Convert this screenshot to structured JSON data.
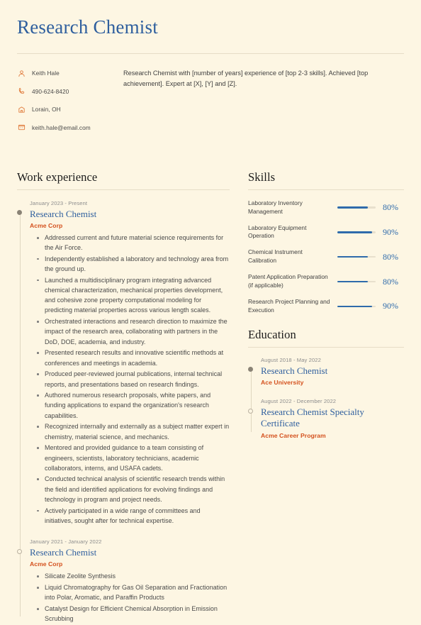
{
  "header": {
    "title": "Research Chemist",
    "contacts": [
      {
        "icon": "person-icon",
        "name": "contact-name",
        "text": "Keith Hale"
      },
      {
        "icon": "phone-icon",
        "name": "contact-phone",
        "text": "490-624-8420"
      },
      {
        "icon": "location-icon",
        "name": "contact-location",
        "text": "Lorain, OH"
      },
      {
        "icon": "email-icon",
        "name": "contact-email",
        "text": "keith.hale@email.com"
      }
    ],
    "summary": "Research Chemist with [number of years] experience of [top 2-3 skills]. Achieved [top achievement]. Expert at [X], [Y] and [Z]."
  },
  "work": {
    "section_title": "Work experience",
    "entries": [
      {
        "date": "January 2023 - Present",
        "role": "Research Chemist",
        "org": "Acme Corp",
        "marker": "filled",
        "bullets": [
          "Addressed current and future material science requirements for the Air Force.",
          "Independently established a laboratory and technology area from the ground up.",
          "Launched a multidisciplinary program integrating advanced chemical characterization, mechanical properties development, and cohesive zone property computational modeling for predicting material properties across various length scales.",
          "Orchestrated interactions and research direction to maximize the impact of the research area, collaborating with partners in the DoD, DOE, academia, and industry.",
          "Presented research results and innovative scientific methods at conferences and meetings in academia.",
          "Produced peer-reviewed journal publications, internal technical reports, and presentations based on research findings.",
          "Authored numerous research proposals, white papers, and funding applications to expand the organization's research capabilities.",
          "Recognized internally and externally as a subject matter expert in chemistry, material science, and mechanics.",
          "Mentored and provided guidance to a team consisting of engineers, scientists, laboratory technicians, academic collaborators, interns, and USAFA cadets.",
          "Conducted technical analysis of scientific research trends within the field and identified applications for evolving findings and technology in program and project needs.",
          "Actively participated in a wide range of committees and initiatives, sought after for technical expertise."
        ]
      },
      {
        "date": "January 2021 - January 2022",
        "role": "Research Chemist",
        "org": "Acme Corp",
        "marker": "hollow",
        "bullets": [
          "Silicate Zeolite Synthesis",
          "Liquid Chromatography for Gas Oil Separation and Fractionation into Polar, Aromatic, and Paraffin Products",
          "Catalyst Design for Efficient Chemical Absorption in Emission Scrubbing"
        ]
      }
    ]
  },
  "skills": {
    "section_title": "Skills",
    "items": [
      {
        "name": "Laboratory Inventory Management",
        "percent": "80%",
        "value": 80
      },
      {
        "name": "Laboratory Equipment Operation",
        "percent": "90%",
        "value": 90
      },
      {
        "name": "Chemical Instrument Calibration",
        "percent": "80%",
        "value": 80
      },
      {
        "name": "Patent Application Preparation (if applicable)",
        "percent": "80%",
        "value": 80
      },
      {
        "name": "Research Project Planning and Execution",
        "percent": "90%",
        "value": 90
      }
    ]
  },
  "education": {
    "section_title": "Education",
    "entries": [
      {
        "date": "August 2018 - May 2022",
        "degree": "Research Chemist",
        "school": "Ace University",
        "marker": "filled"
      },
      {
        "date": "August 2022 - December 2022",
        "degree": "Research Chemist Specialty Certificate",
        "school": "Acme Career Program",
        "marker": "hollow"
      }
    ]
  },
  "colors": {
    "background": "#fdf6e3",
    "accent_blue": "#2f5f9e",
    "accent_orange": "#d4511e",
    "icon_orange": "#e07b3c",
    "rule": "#e6ddc6"
  }
}
